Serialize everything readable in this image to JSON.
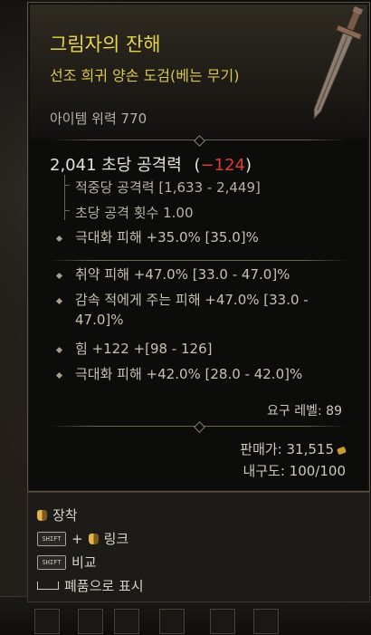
{
  "item": {
    "name": "그림자의 잔해",
    "type": "선조 희귀 양손 도검(베는 무기)",
    "power": "아이템 위력 770"
  },
  "stats": {
    "dps_value": "2,041 초당 공격력",
    "dps_open": "(",
    "dps_delta": "−124",
    "dps_close": ")",
    "hit_damage": "적중당 공격력 [1,633 - 2,449]",
    "attack_speed": "초당 공격 횟수 1.00",
    "implicit": "극대화 피해 +35.0% [35.0]%"
  },
  "affixes": [
    {
      "text": "취약 피해 +47.0% [33.0 - 47.0]%"
    },
    {
      "text": "감속 적에게 주는 피해 +47.0% [33.0 - 47.0]%"
    },
    {
      "text": "힘 +122 +[98 - 126]"
    },
    {
      "text": "극대화 피해 +42.0% [28.0 - 42.0]%"
    }
  ],
  "requirements": {
    "level": "요구 레벨: 89"
  },
  "footer": {
    "sell_value": "판매가: 31,515",
    "durability": "내구도: 100/100"
  },
  "actions": {
    "equip": "장착",
    "link_plus": "+",
    "link": "링크",
    "compare": "비교",
    "junk": "폐품으로 표시",
    "shift_key": "SHIFT"
  },
  "colors": {
    "title": "#e6d44a",
    "delta_negative": "#e03a32"
  }
}
